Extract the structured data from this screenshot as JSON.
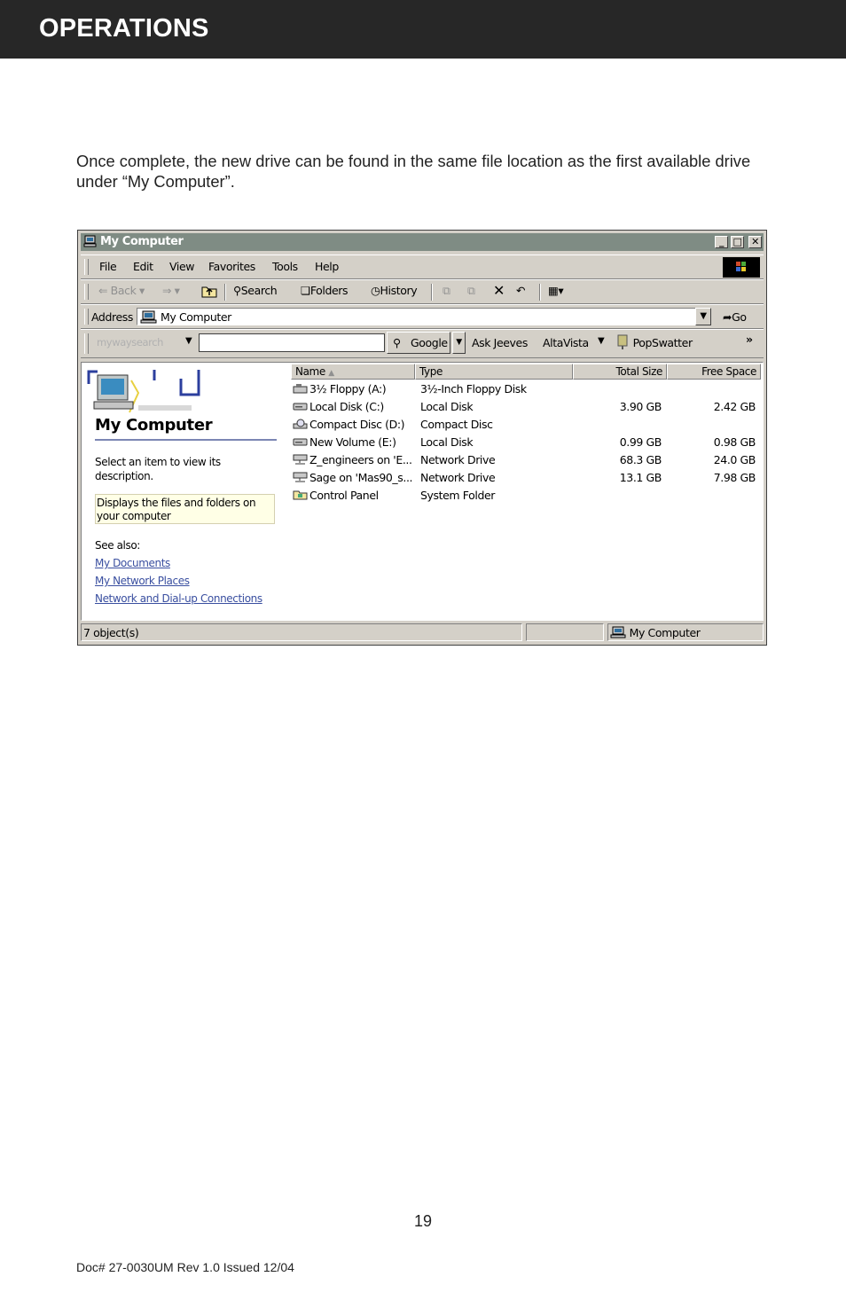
{
  "header": {
    "title": "OPERATIONS"
  },
  "intro_text": "Once complete, the new drive can be found in the same file location as the first available drive under “My Computer”.",
  "window": {
    "title": "My Computer",
    "controls": {
      "minimize": "_",
      "maximize": "□",
      "close": "✕"
    },
    "menu": [
      "File",
      "Edit",
      "View",
      "Favorites",
      "Tools",
      "Help"
    ],
    "toolbar": {
      "back": "Back",
      "search": "Search",
      "folders": "Folders",
      "history": "History"
    },
    "address": {
      "label": "Address",
      "value": "My Computer",
      "go": "Go"
    },
    "searchbar": {
      "brand": "mywaysearch",
      "input_value": "",
      "google": "Google",
      "links": [
        "Ask Jeeves",
        "AltaVista",
        "PopSwatter"
      ],
      "more": "»"
    },
    "left_pane": {
      "title": "My Computer",
      "hint": "Select an item to view its description.",
      "note": "Displays the files and folders on your computer",
      "see_also_label": "See also:",
      "links": [
        "My Documents",
        "My Network Places",
        "Network and Dial-up Connections"
      ]
    },
    "columns": [
      "Name",
      "Type",
      "Total Size",
      "Free Space"
    ],
    "items": [
      {
        "icon": "floppy-drive-icon",
        "name": "3½ Floppy (A:)",
        "type": "3½-Inch Floppy Disk",
        "total": "",
        "free": ""
      },
      {
        "icon": "hard-disk-icon",
        "name": "Local Disk (C:)",
        "type": "Local Disk",
        "total": "3.90 GB",
        "free": "2.42 GB"
      },
      {
        "icon": "cd-drive-icon",
        "name": "Compact Disc (D:)",
        "type": "Compact Disc",
        "total": "",
        "free": ""
      },
      {
        "icon": "hard-disk-icon",
        "name": "New Volume (E:)",
        "type": "Local Disk",
        "total": "0.99 GB",
        "free": "0.98 GB"
      },
      {
        "icon": "network-drive-icon",
        "name": "Z_engineers on 'E...",
        "type": "Network Drive",
        "total": "68.3 GB",
        "free": "24.0 GB"
      },
      {
        "icon": "network-drive-icon",
        "name": "Sage on 'Mas90_s...",
        "type": "Network Drive",
        "total": "13.1 GB",
        "free": "7.98 GB"
      },
      {
        "icon": "control-panel-icon",
        "name": "Control Panel",
        "type": "System Folder",
        "total": "",
        "free": ""
      }
    ],
    "status": {
      "count": "7 object(s)",
      "location": "My Computer"
    }
  },
  "page_number": "19",
  "doc_id": "Doc# 27-0030UM Rev 1.0 Issued  12/04"
}
